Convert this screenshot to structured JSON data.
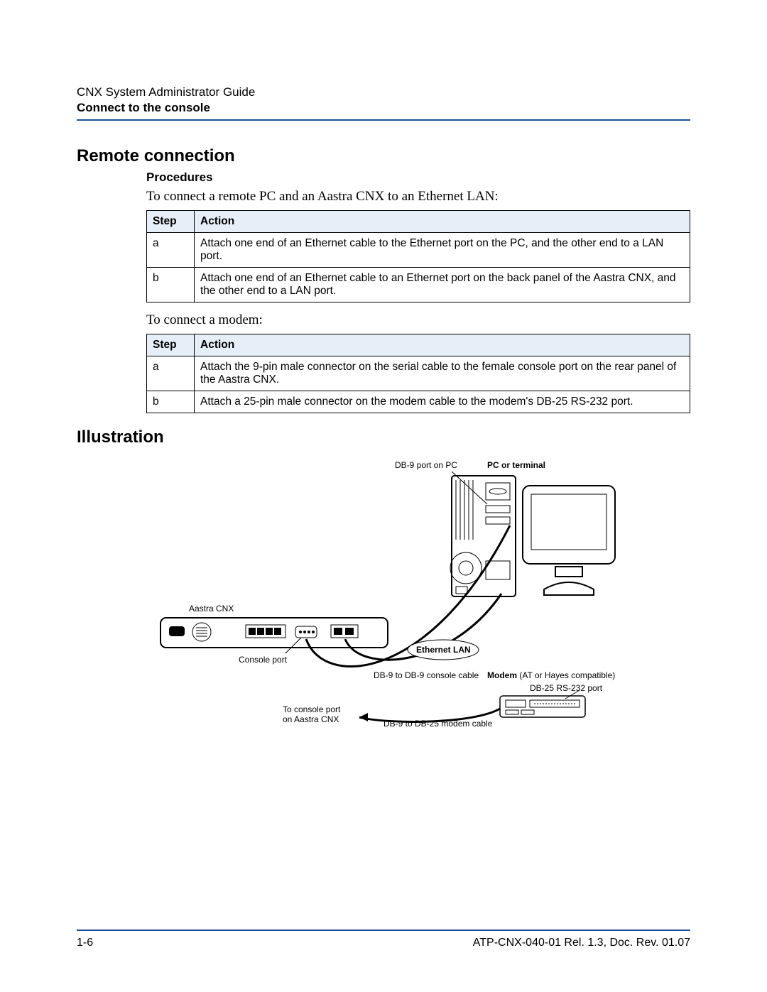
{
  "header": {
    "doc_title": "CNX System Administrator Guide",
    "doc_section": "Connect to the console"
  },
  "h1_remote": "Remote connection",
  "h2_procedures": "Procedures",
  "intro1": "To connect a remote PC and an Aastra CNX to an Ethernet LAN:",
  "table1": {
    "col_step": "Step",
    "col_action": "Action",
    "rows": [
      {
        "step": "a",
        "action": "Attach one end of an Ethernet cable to the Ethernet port on the PC, and the other end to a LAN port."
      },
      {
        "step": "b",
        "action": "Attach one end of an Ethernet cable to an Ethernet port on the back panel of the Aastra CNX, and the other end to a LAN port."
      }
    ]
  },
  "intro2": "To connect a modem:",
  "table2": {
    "col_step": "Step",
    "col_action": "Action",
    "rows": [
      {
        "step": "a",
        "action": "Attach the 9-pin male connector on the serial cable to the female console port on the rear panel of the Aastra CNX."
      },
      {
        "step": "b",
        "action": "Attach a 25-pin male connector on the modem cable to the modem's DB-25 RS-232 port."
      }
    ]
  },
  "h1_illustration": "Illustration",
  "diagram": {
    "db9_pc": "DB-9 port on PC",
    "pc_terminal": "PC or terminal",
    "aastra": "Aastra CNX",
    "console_port": "Console port",
    "ethernet_lan": "Ethernet LAN",
    "db9_db9": "DB-9 to DB-9 console cable",
    "modem": "Modem",
    "modem_paren": " (AT or Hayes compatible)",
    "db25_port": "DB-25 RS-232 port",
    "to_console": "To console port\non Aastra CNX",
    "db9_db25": "DB-9 to DB-25 modem cable"
  },
  "footer": {
    "page": "1-6",
    "right": "ATP-CNX-040-01 Rel. 1.3, Doc. Rev. 01.07"
  }
}
